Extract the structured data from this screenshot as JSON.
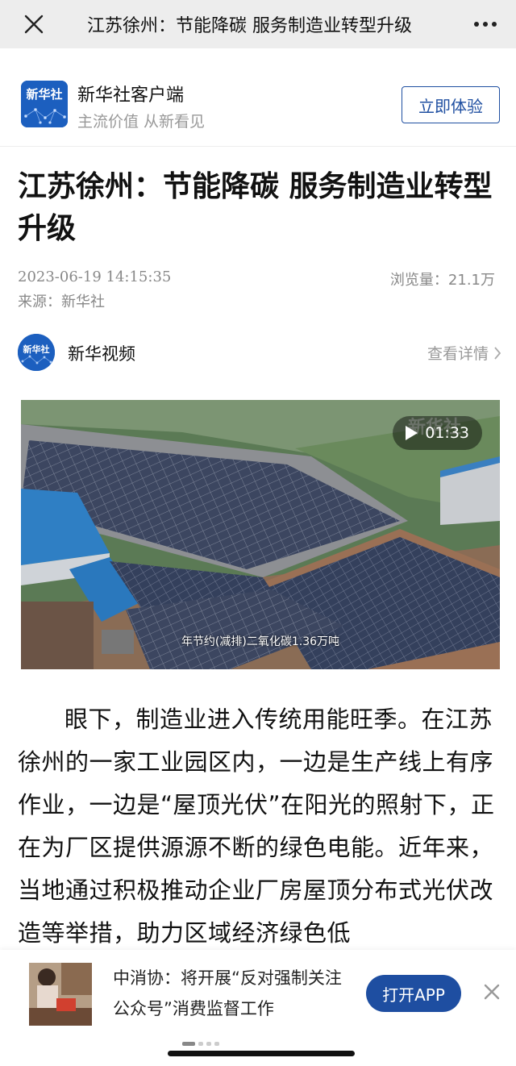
{
  "topbar": {
    "title": "江苏徐州：节能降碳 服务制造业转型升级",
    "close_icon": "close-icon",
    "more_icon": "more-icon"
  },
  "promo": {
    "app_name": "新华社客户端",
    "slogan": "主流价值 从新看见",
    "button_label": "立即体验",
    "logo_text": "新华社"
  },
  "article": {
    "title": "江苏徐州：节能降碳 服务制造业转型升级",
    "date": "2023-06-19 14:15:35",
    "views": "浏览量：21.1万",
    "source": "来源：新华社"
  },
  "author": {
    "name": "新华视频",
    "link_label": "查看详情",
    "avatar_text": "新华社"
  },
  "video": {
    "duration": "01:33",
    "caption": "年节约(减排)二氧化碳1.36万吨",
    "watermark": "新华社"
  },
  "body": {
    "paragraph": "眼下，制造业进入传统用能旺季。在江苏徐州的一家工业园区内，一边是生产线上有序作业，一边是“屋顶光伏”在阳光的照射下，正在为厂区提供源源不断的绿色电能。近年来，当地通过积极推动企业厂房屋顶分布式光伏改造等举措，助力区域经济绿色低"
  },
  "recommend": {
    "text": "中消协：将开展“反对强制关注公众号”消费监督工作",
    "button_label": "打开APP"
  },
  "colors": {
    "brand_blue": "#1e4ea1",
    "topbar_bg": "#ededed",
    "muted_text": "#999999"
  }
}
